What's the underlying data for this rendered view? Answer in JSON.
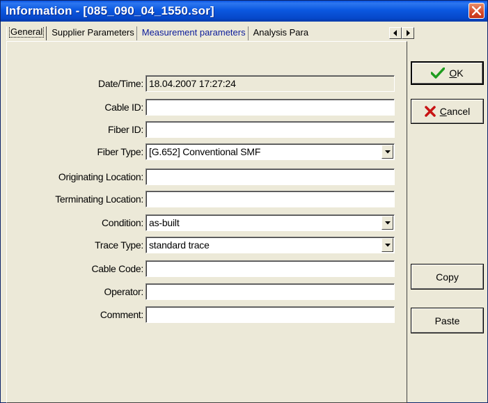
{
  "window": {
    "title": "Information - [085_090_04_1550.sor]",
    "close_icon": "close-icon"
  },
  "tabs": [
    {
      "label": "General",
      "active": true
    },
    {
      "label": "Supplier Parameters",
      "active": false
    },
    {
      "label": "Measurement parameters",
      "active": false
    },
    {
      "label": "Analysis Para",
      "active": false
    }
  ],
  "fields": {
    "datetime": {
      "label": "Date/Time:",
      "value": "18.04.2007   17:27:24"
    },
    "cable_id": {
      "label": "Cable ID:",
      "value": ""
    },
    "fiber_id": {
      "label": "Fiber ID:",
      "value": ""
    },
    "fiber_type": {
      "label": "Fiber Type:",
      "value": "[G.652] Conventional SMF"
    },
    "orig_loc": {
      "label": "Originating Location:",
      "value": ""
    },
    "term_loc": {
      "label": "Terminating Location:",
      "value": ""
    },
    "condition": {
      "label": "Condition:",
      "value": "as-built"
    },
    "trace_type": {
      "label": "Trace Type:",
      "value": "standard trace"
    },
    "cable_code": {
      "label": "Cable Code:",
      "value": ""
    },
    "operator": {
      "label": "Operator:",
      "value": ""
    },
    "comment": {
      "label": "Comment:",
      "value": ""
    }
  },
  "buttons": {
    "ok": {
      "u": "O",
      "rest": "K"
    },
    "cancel": {
      "u": "C",
      "rest": "ancel"
    },
    "copy": "Copy",
    "paste": "Paste"
  },
  "colors": {
    "titlebar": "#0a54e4",
    "ok_check": "#1e9c1e",
    "cancel_x": "#c81414"
  }
}
